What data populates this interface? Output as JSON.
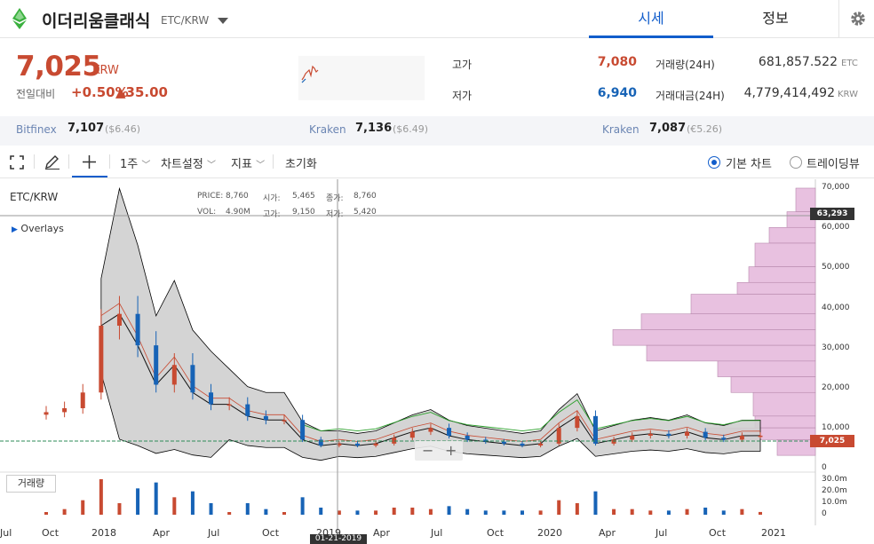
{
  "header": {
    "coin_name": "이더리움클래식",
    "pair": "ETC/KRW",
    "tabs": [
      "시세",
      "정보"
    ]
  },
  "price": {
    "current": "7,025",
    "unit": "KRW",
    "change_label": "전일대비",
    "change_rate": "+0.50%",
    "change_price": "▲35.00"
  },
  "stats": {
    "high_label": "고가",
    "high_value": "7,080",
    "low_label": "저가",
    "low_value": "6,940",
    "volume_label": "거래량(24H)",
    "volume_value": "681,857.522",
    "volume_unit": "ETC",
    "amount_label": "거래대금(24H)",
    "amount_value": "4,779,414,492",
    "amount_unit": "KRW"
  },
  "exchanges": [
    {
      "name": "Bitfinex",
      "price": "7,107",
      "alt": "($6.46)"
    },
    {
      "name": "Kraken",
      "price": "7,136",
      "alt": "($6.49)"
    },
    {
      "name": "Kraken",
      "price": "7,087",
      "alt": "(€5.26)"
    }
  ],
  "toolbar": {
    "interval": "1주",
    "chart_settings": "차트설정",
    "indicators": "지표",
    "reset": "초기화",
    "basic_chart": "기본 차트",
    "tradingview": "트레이딩뷰"
  },
  "chart": {
    "pair": "ETC/KRW",
    "overlays_label": "Overlays",
    "info": {
      "price_label": "PRICE:",
      "price_value": "8,760",
      "open_label": "시가:",
      "open_value": "5,465",
      "close_label": "종가:",
      "close_value": "8,760",
      "vol_label": "VOL:",
      "vol_value": "4.90M",
      "high_label": "고가:",
      "high_value": "9,150",
      "low_label": "저가:",
      "low_value": "5,420"
    },
    "y_ticks": [
      "70,000",
      "60,000",
      "50,000",
      "40,000",
      "30,000",
      "20,000",
      "10,000",
      "0"
    ],
    "vol_ticks": [
      "30.0m",
      "20.0m",
      "10.0m",
      "0"
    ],
    "x_ticks": [
      "Jul",
      "Oct",
      "2018",
      "Apr",
      "Jul",
      "Oct",
      "2019",
      "Apr",
      "Jul",
      "Oct",
      "2020",
      "Apr",
      "Jul",
      "Oct",
      "2021"
    ],
    "hover_price": "63,293",
    "current_price_tag": "7,025",
    "crosshair_date": "01-21-2019",
    "volume_button": "거래량",
    "colors": {
      "up": "#c84a31",
      "down": "#1763b6",
      "accent": "#115dcb",
      "profile": "#e8c1e0"
    }
  },
  "chart_data": {
    "type": "candlestick",
    "interval": "1주",
    "x": [
      "2017-09",
      "2017-10",
      "2017-11",
      "2017-12",
      "2018-01",
      "2018-02",
      "2018-03",
      "2018-04",
      "2018-05",
      "2018-06",
      "2018-07",
      "2018-08",
      "2018-09",
      "2018-10",
      "2018-11",
      "2018-12",
      "2019-01",
      "2019-02",
      "2019-03",
      "2019-04",
      "2019-05",
      "2019-06",
      "2019-07",
      "2019-08",
      "2019-09",
      "2019-10",
      "2019-11",
      "2019-12",
      "2020-01",
      "2020-02",
      "2020-03",
      "2020-04",
      "2020-05",
      "2020-06",
      "2020-07",
      "2020-08",
      "2020-09",
      "2020-10",
      "2020-11",
      "2020-12"
    ],
    "close": [
      13000,
      14000,
      18000,
      35000,
      38000,
      30000,
      20000,
      25000,
      18000,
      15000,
      15000,
      12000,
      11000,
      11000,
      6000,
      4500,
      5000,
      4500,
      5000,
      6500,
      8000,
      9000,
      7000,
      6000,
      5500,
      5000,
      4500,
      5000,
      9000,
      12000,
      5000,
      6000,
      7000,
      7500,
      7000,
      8000,
      6500,
      6000,
      7000,
      7025
    ],
    "y_range": [
      0,
      72000
    ],
    "volume_y_range": [
      0,
      30000000
    ],
    "hover": {
      "price": 63293
    },
    "last": 7025
  }
}
